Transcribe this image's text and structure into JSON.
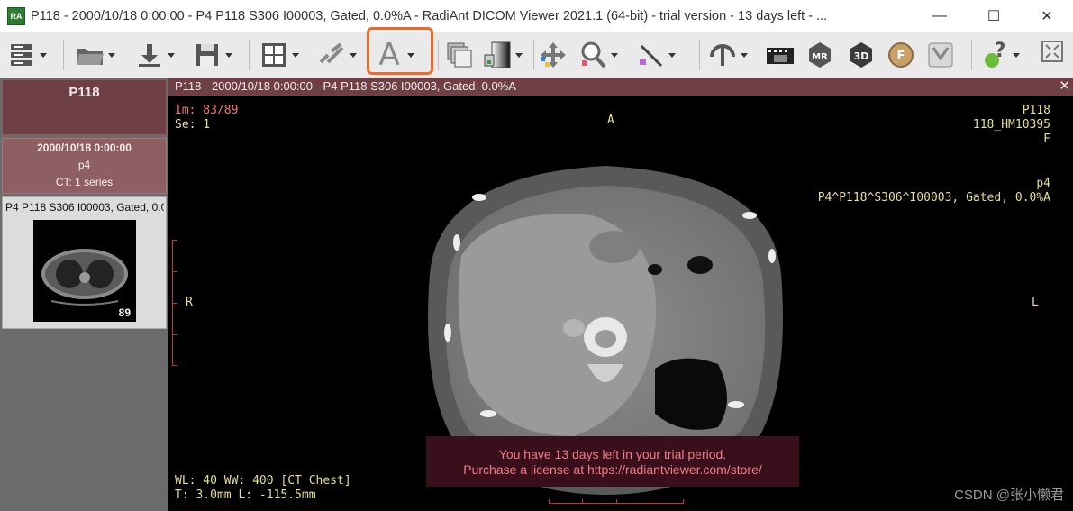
{
  "window": {
    "app_icon_text": "RA",
    "title": "P118 - 2000/10/18 0:00:00 - P4 P118 S306 I00003, Gated, 0.0%A - RadiAnt DICOM Viewer 2021.1 (64-bit) - trial version - 13 days left - ...",
    "minimize": "—",
    "maximize": "☐",
    "close": "✕"
  },
  "toolbar": {
    "items": [
      {
        "name": "database-icon"
      },
      {
        "name": "open-folder-icon"
      },
      {
        "name": "download-icon"
      },
      {
        "name": "save-icon"
      },
      {
        "name": "layout-grid-icon"
      },
      {
        "name": "link-icon"
      },
      {
        "name": "annotation-text-icon",
        "label": "A"
      },
      {
        "name": "series-stack-icon"
      },
      {
        "name": "window-level-icon"
      },
      {
        "name": "pan-icon"
      },
      {
        "name": "zoom-icon"
      },
      {
        "name": "measure-icon"
      },
      {
        "name": "reset-icon"
      },
      {
        "name": "cine-icon"
      },
      {
        "name": "mpr-icon",
        "label": "MPR"
      },
      {
        "name": "3d-icon",
        "label": "3D"
      },
      {
        "name": "fusion-icon",
        "label": "F"
      },
      {
        "name": "flip-icon"
      },
      {
        "name": "help-icon"
      },
      {
        "name": "fullscreen-icon"
      }
    ],
    "accent_highlight": "#ee6a2b"
  },
  "sidebar": {
    "patient": "P118",
    "study": {
      "date": "2000/10/18 0:00:00",
      "description": "p4",
      "series_count": "CT: 1 series"
    },
    "series": {
      "label": "P4 P118 S306 I00003, Gated, 0.0%A",
      "image_count": "89"
    }
  },
  "viewer": {
    "header": "P118 - 2000/10/18 0:00:00 - P4 P118 S306 I00003, Gated, 0.0%A",
    "close_icon": "✕",
    "overlay": {
      "image_index": "Im: 83/89",
      "series": "Se: 1",
      "orientation_top": "A",
      "orientation_left": "R",
      "orientation_right": "L",
      "patient_id": "P118",
      "accession": "118_HM10395",
      "sex": "F",
      "study_desc": "p4",
      "series_desc": "P4^P118^S306^I00003, Gated, 0.0%A",
      "window": "WL: 40 WW: 400 [CT Chest]",
      "thickness": "T: 3.0mm L: -115.5mm"
    },
    "trial_notice": {
      "line1": "You have 13 days left in your trial period.",
      "line2": "Purchase a license at https://radiantviewer.com/store/"
    },
    "watermark": "CSDN @张小懒君"
  }
}
